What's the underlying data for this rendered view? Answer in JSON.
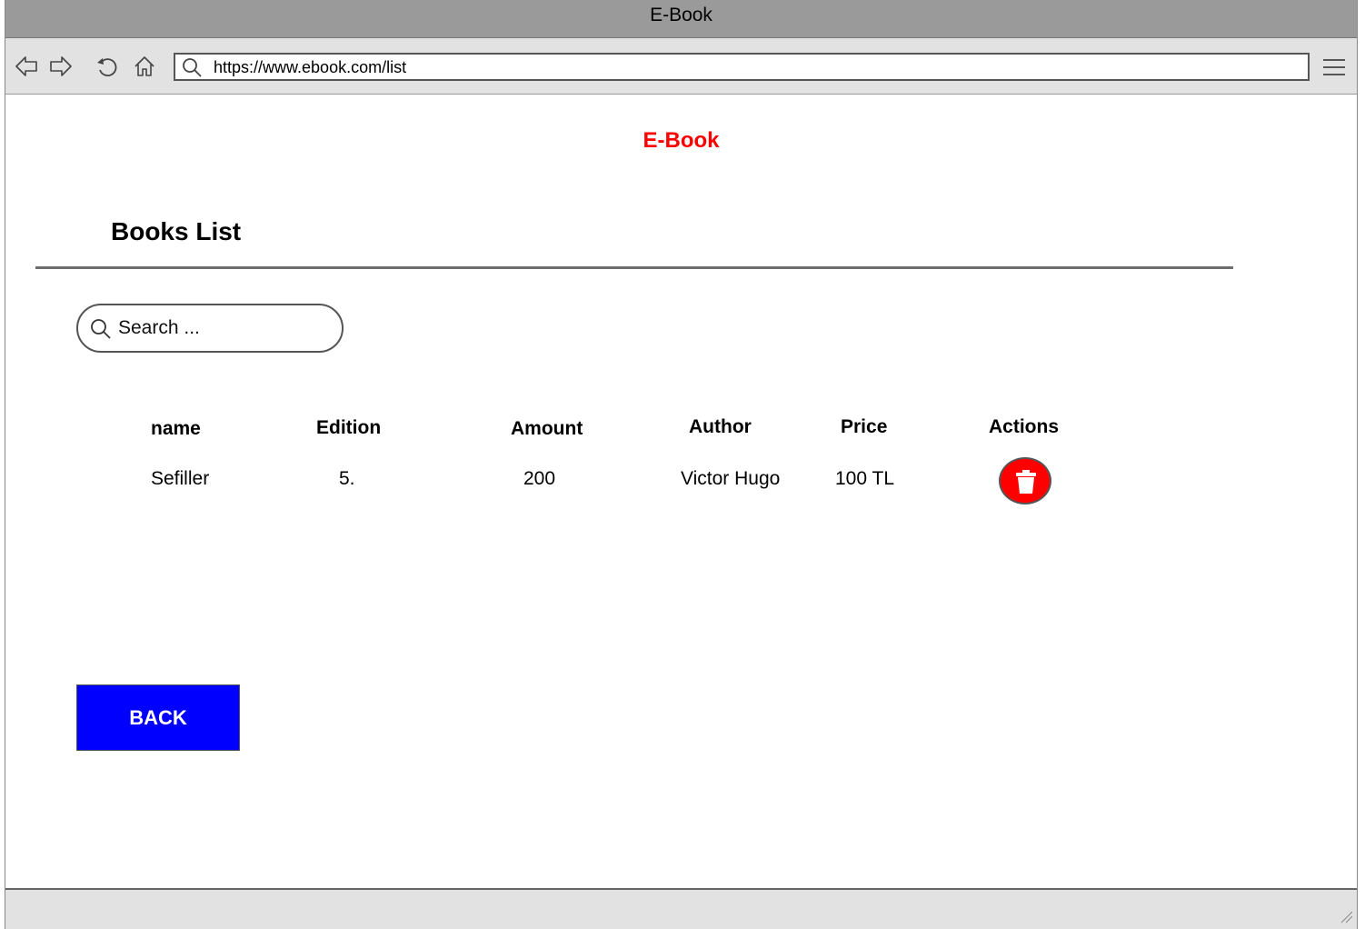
{
  "window": {
    "title": "E-Book"
  },
  "browser": {
    "url": "https://www.ebook.com/list"
  },
  "page": {
    "brand": "E-Book",
    "heading": "Books List",
    "search": {
      "placeholder": "Search ..."
    },
    "table": {
      "headers": [
        "name",
        "Edition",
        "Amount",
        "Author",
        "Price",
        "Actions"
      ],
      "rows": [
        {
          "name": "Sefiller",
          "edition": "5.",
          "amount": "200",
          "author": "Victor Hugo",
          "price": "100 TL"
        }
      ]
    },
    "back_label": "BACK"
  },
  "colors": {
    "brand": "#ff0000",
    "delete": "#ff0000",
    "back": "#0000ff",
    "titlebar": "#9a9a9a",
    "chrome": "#e2e2e2"
  },
  "icons": [
    "back-arrow-icon",
    "forward-arrow-icon",
    "reload-icon",
    "home-icon",
    "search-icon",
    "menu-icon",
    "trash-icon",
    "resize-grip-icon"
  ]
}
